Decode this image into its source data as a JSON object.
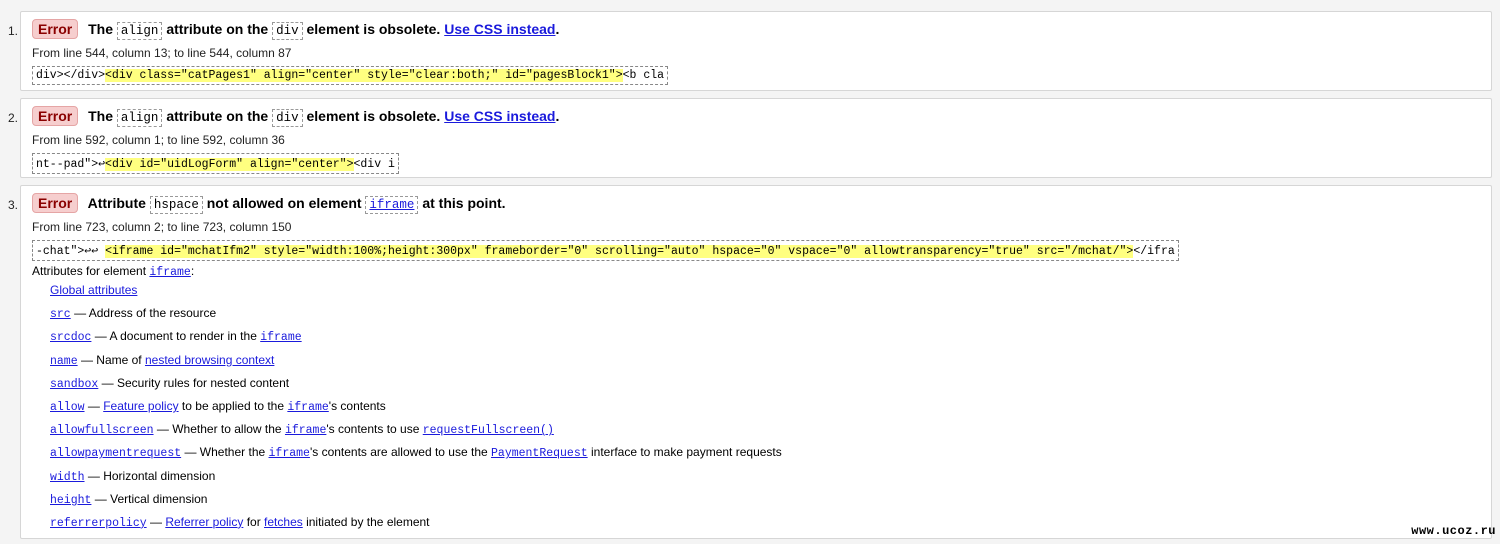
{
  "errors": [
    {
      "number": "1.",
      "badge": "Error",
      "msg_before": "The",
      "attr": "align",
      "msg_middle": "attribute on the",
      "element": "div",
      "msg_after": "element is obsolete.",
      "link": "Use CSS instead",
      "end": ".",
      "location": "From line 544, column 13; to line 544, column 87",
      "extract_pre": "div></div>",
      "extract_hl": "<div class=\"catPages1\" align=\"center\" style=\"clear:both;\" id=\"pagesBlock1\">",
      "extract_post": "<b cla"
    },
    {
      "number": "2.",
      "badge": "Error",
      "msg_before": "The",
      "attr": "align",
      "msg_middle": "attribute on the",
      "element": "div",
      "msg_after": "element is obsolete.",
      "link": "Use CSS instead",
      "end": ".",
      "location": "From line 592, column 1; to line 592, column 36",
      "extract_pre": "nt--pad\">↩",
      "extract_hl": "<div id=\"uidLogForm\" align=\"center\">",
      "extract_post": "<div i"
    },
    {
      "number": "3.",
      "badge": "Error",
      "msg_before": "Attribute",
      "attr": "hspace",
      "msg_middle": "not allowed on element",
      "element": "iframe",
      "msg_after": "at this point.",
      "location": "From line 723, column 2; to line 723, column 150",
      "extract_pre": "-chat\">↩↩ ",
      "extract_hl": "<iframe id=\"mchatIfm2\" style=\"width:100%;height:300px\" frameborder=\"0\" scrolling=\"auto\" hspace=\"0\" vspace=\"0\" allowtransparency=\"true\" src=\"/mchat/\">",
      "extract_post": "</ifra",
      "attrs_heading": "Attributes for element",
      "attrs_element": "iframe",
      "attrs_colon": ":",
      "global_attributes": "Global attributes",
      "attributes": {
        "src": {
          "name": "src",
          "desc": "— Address of the resource"
        },
        "srcdoc": {
          "name": "srcdoc",
          "desc1": "— A document to render in the",
          "code": "iframe"
        },
        "name": {
          "name": "name",
          "desc1": "— Name of",
          "link": "nested browsing context"
        },
        "sandbox": {
          "name": "sandbox",
          "desc": "— Security rules for nested content"
        },
        "allow": {
          "name": "allow",
          "dash": "—",
          "link": "Feature policy",
          "desc1": "to be applied to the",
          "code": "iframe",
          "desc2": "'s contents"
        },
        "allowfullscreen": {
          "name": "allowfullscreen",
          "desc1": "— Whether to allow the",
          "code": "iframe",
          "desc2": "'s contents to use",
          "code2": "requestFullscreen()"
        },
        "allowpaymentrequest": {
          "name": "allowpaymentrequest",
          "desc1": "— Whether the",
          "code": "iframe",
          "desc2": "'s contents are allowed to use the",
          "code2": "PaymentRequest",
          "desc3": "interface to make payment requests"
        },
        "width": {
          "name": "width",
          "desc": "— Horizontal dimension"
        },
        "height": {
          "name": "height",
          "desc": "— Vertical dimension"
        },
        "referrerpolicy": {
          "name": "referrerpolicy",
          "dash": "—",
          "link": "Referrer policy",
          "desc1": "for",
          "link2": "fetches",
          "desc2": "initiated by the element"
        }
      }
    }
  ],
  "watermark": "www.ucoz.ru",
  "colors": {
    "badge_bg": "#f6cece",
    "badge_text": "#8a0000",
    "highlight": "#ffff80",
    "link": "#1a1adc"
  }
}
